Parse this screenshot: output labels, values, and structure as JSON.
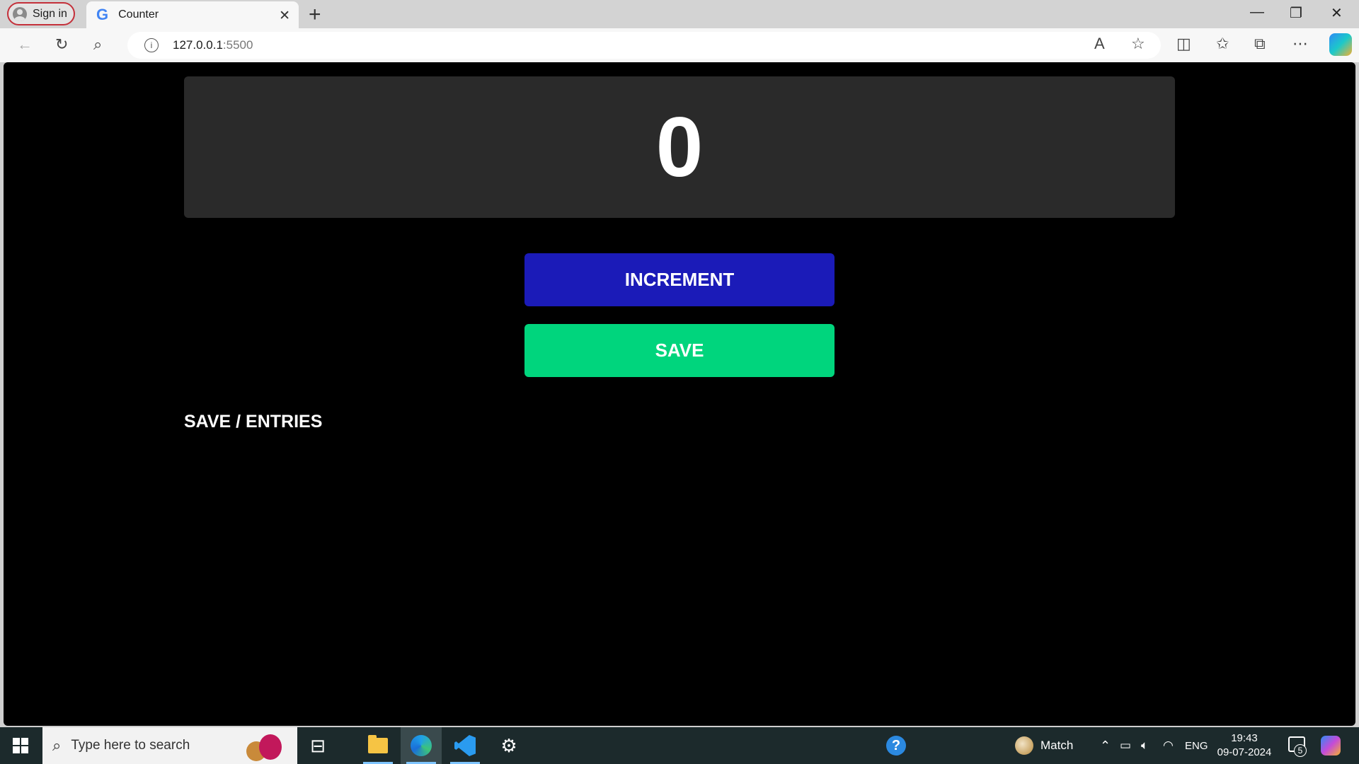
{
  "browser": {
    "profile_label": "Sign in",
    "tab_title": "Counter",
    "tab_close": "✕",
    "new_tab": "+",
    "address": {
      "host": "127.0.0.1",
      "port": ":5500"
    },
    "window_controls": {
      "minimize": "—",
      "restore": "❐",
      "close": "✕"
    }
  },
  "page": {
    "counter_value": "0",
    "increment_label": "INCREMENT",
    "save_label": "SAVE",
    "entries_label": "SAVE / ENTRIES"
  },
  "taskbar": {
    "search_placeholder": "Type here to search",
    "weather_label": "Match",
    "language": "ENG",
    "time": "19:43",
    "date": "09-07-2024",
    "notification_count": "5"
  },
  "colors": {
    "page_background": "#000000",
    "counter_panel": "#2a2a2a",
    "increment_button": "#1b1bb8",
    "save_button": "#00d57d",
    "taskbar": "#1c2a2c"
  }
}
